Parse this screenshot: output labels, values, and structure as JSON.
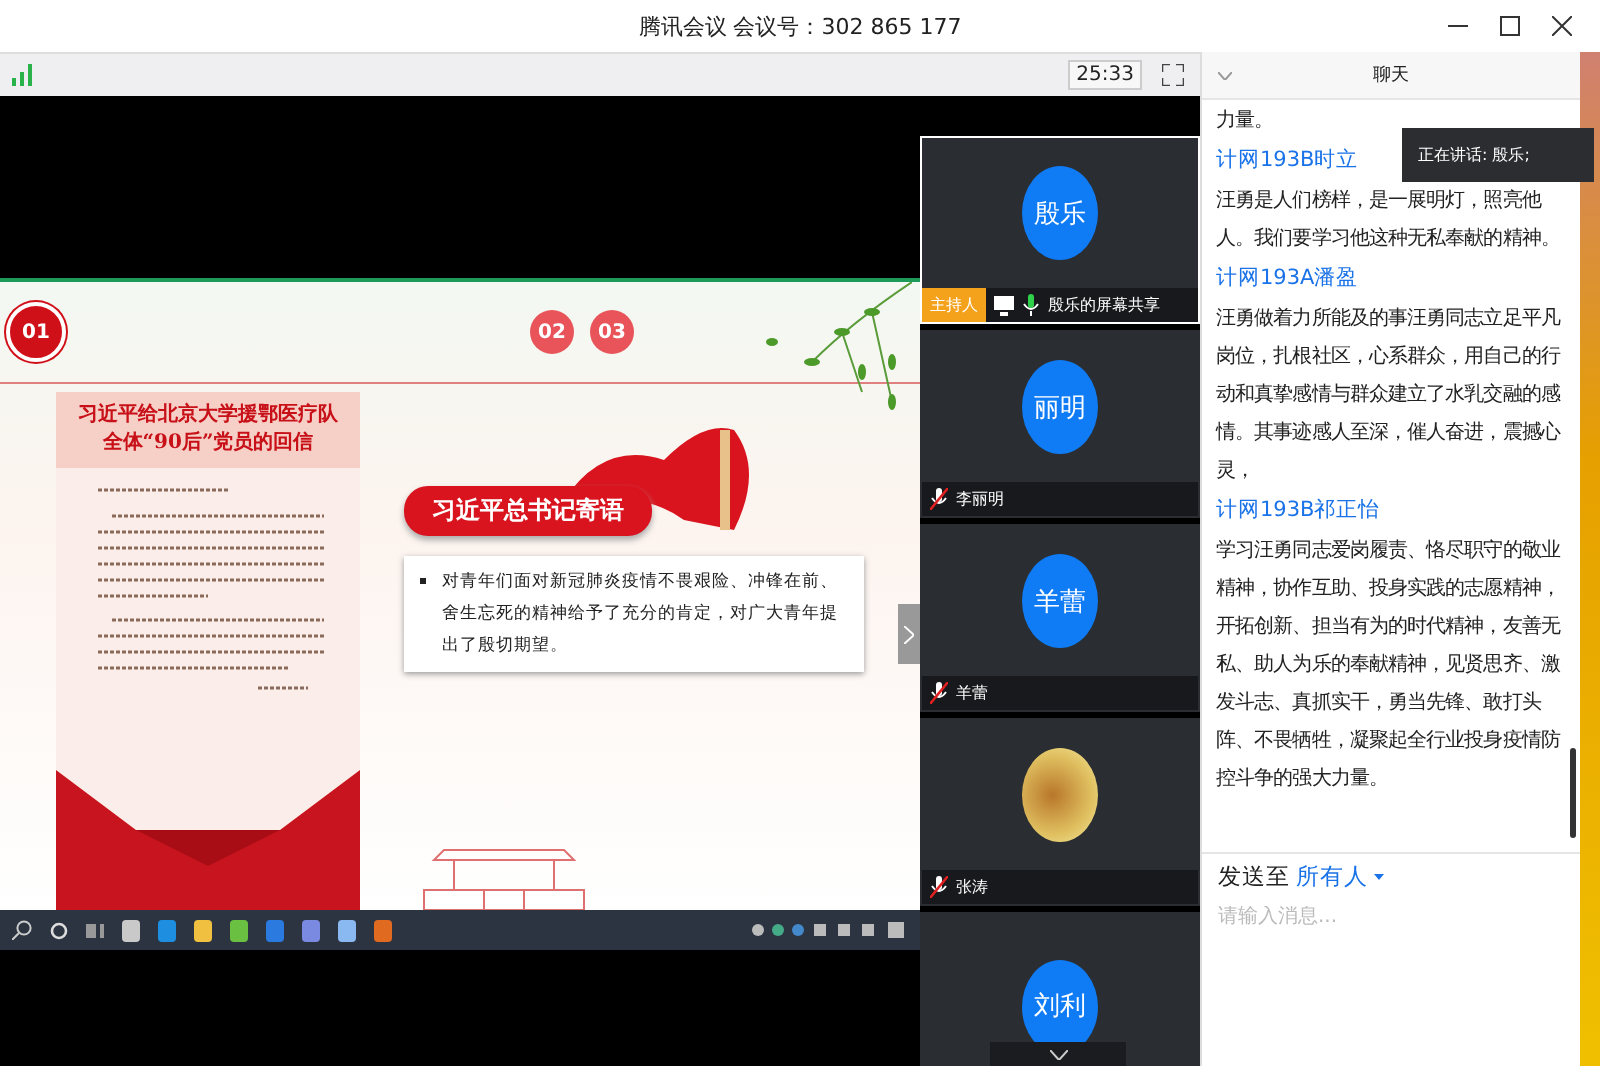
{
  "window": {
    "title": "腾讯会议 会议号：302 865 177"
  },
  "toolbar": {
    "timer": "25:33"
  },
  "shared_screen": {
    "step_markers": [
      {
        "label": "01",
        "selected": true
      },
      {
        "label": "02",
        "selected": false
      },
      {
        "label": "03",
        "selected": false
      }
    ],
    "letter_title_lines": [
      "习近平给北京大学援鄂医疗队",
      "全体“90后”党员的回信"
    ],
    "banner": "习近平总书记寄语",
    "quote": "对青年们面对新冠肺炎疫情不畏艰险、冲锋在前、舍生忘死的精神给予了充分的肯定，对广大青年提出了殷切期望。"
  },
  "participants": [
    {
      "kind": "initials",
      "avatar_text": "殷乐",
      "host_badge": "主持人",
      "sharing": true,
      "muted": false,
      "name": "殷乐的屏幕共享",
      "selected": true
    },
    {
      "kind": "initials",
      "avatar_text": "丽明",
      "muted": true,
      "sharing": false,
      "name": "李丽明",
      "selected": false
    },
    {
      "kind": "initials",
      "avatar_text": "羊蕾",
      "muted": true,
      "sharing": false,
      "name": "羊蕾",
      "selected": false
    },
    {
      "kind": "photo",
      "muted": true,
      "sharing": false,
      "name": "张涛",
      "selected": false
    },
    {
      "kind": "initials",
      "avatar_text": "刘利",
      "selected": false
    }
  ],
  "speaking_tooltip": "正在讲话: 殷乐;",
  "chat": {
    "title": "聊天",
    "messages": [
      {
        "text": "力量。"
      },
      {
        "sender": "计网193B时立",
        "text": "汪勇是人们榜样，是一展明灯，照亮他人。我们要学习他这种无私奉献的精神。"
      },
      {
        "sender": "计网193A潘盈",
        "text": "汪勇做着力所能及的事汪勇同志立足平凡岗位，扎根社区，心系群众，用自己的行动和真挚感情与群众建立了水乳交融的感情。其事迹感人至深，催人奋进，震撼心灵，"
      },
      {
        "sender": "计网193B祁正怡",
        "text": "学习汪勇同志爱岗履责、恪尽职守的敬业精神，协作互助、投身实践的志愿精神，开拓创新、担当有为的时代精神，友善无私、助人为乐的奉献精神，见贤思齐、激发斗志、真抓实干，勇当先锋、敢打头阵、不畏牺牲，凝聚起全行业投身疫情防控斗争的强大力量。"
      }
    ],
    "send_to_label": "发送至",
    "recipient": "所有人",
    "placeholder": "请输入消息..."
  }
}
